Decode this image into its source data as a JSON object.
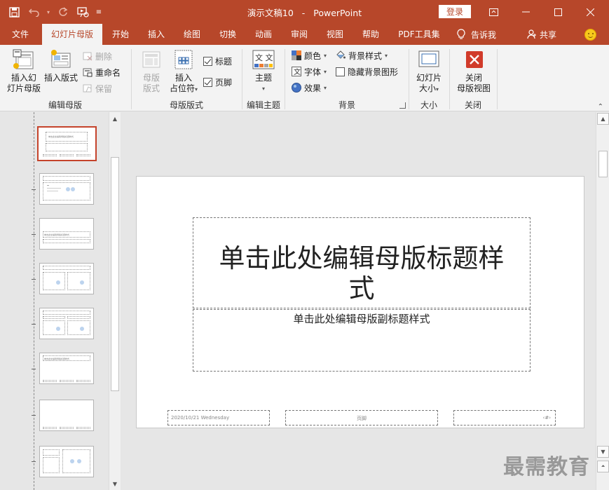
{
  "window": {
    "doc_name": "演示文稿10",
    "separator": "-",
    "app_name": "PowerPoint",
    "login_label": "登录"
  },
  "tabs": [
    {
      "label": "文件"
    },
    {
      "label": "幻灯片母版"
    },
    {
      "label": "开始"
    },
    {
      "label": "插入"
    },
    {
      "label": "绘图"
    },
    {
      "label": "切换"
    },
    {
      "label": "动画"
    },
    {
      "label": "审阅"
    },
    {
      "label": "视图"
    },
    {
      "label": "帮助"
    },
    {
      "label": "PDF工具集"
    }
  ],
  "tell_me": "告诉我",
  "share": "共享",
  "ribbon": {
    "edit_master": {
      "label": "编辑母版",
      "insert_slide_master": "插入幻\n灯片母版",
      "insert_layout": "插入版式",
      "delete": "删除",
      "rename": "重命名",
      "preserve": "保留"
    },
    "master_layout": {
      "label": "母版版式",
      "master_layout_btn": "母版\n版式",
      "insert_placeholder": "插入\n占位符",
      "title_check": "标题",
      "footer_check": "页脚"
    },
    "edit_theme": {
      "label": "编辑主题",
      "theme": "主题",
      "theme_icon_text": "文 文"
    },
    "background": {
      "label": "背景",
      "colors": "颜色",
      "fonts": "字体",
      "effects": "效果",
      "bg_styles": "背景样式",
      "hide_bg": "隐藏背景图形"
    },
    "size": {
      "label": "大小",
      "slide_size": "幻灯片\n大小"
    },
    "close": {
      "label": "关闭",
      "close_master": "关闭\n母版视图"
    }
  },
  "slide": {
    "title_line1": "单击此处编辑母版标题样",
    "title_line2": "式",
    "subtitle": "单击此处编辑母版副标题样式",
    "date": "2020/10/21 Wednesday",
    "footer": "页脚",
    "page_num": "‹#›"
  },
  "thumbnails": {
    "t1_text": "单击此处编辑母版标题样式",
    "t3_text": "单击此处编辑母版标题样式",
    "t6_text": "单击此处编辑母版标题样式"
  },
  "watermark": "最需教育",
  "colors": {
    "accent": "#b7472a",
    "ribbon_bg": "#f3f3f3",
    "selected_thumb_border": "#c5432b"
  }
}
